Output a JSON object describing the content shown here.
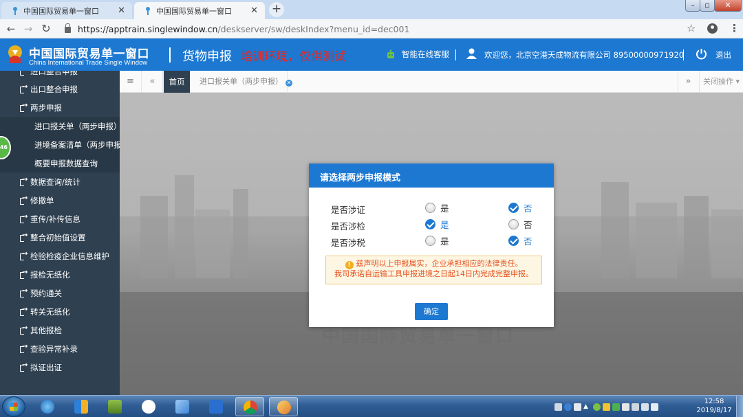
{
  "browser": {
    "tabs": [
      {
        "title": "中国国际贸易单一窗口",
        "active": false
      },
      {
        "title": "中国国际贸易单一窗口",
        "active": true
      }
    ],
    "url_host": "https://apptrain.singlewindow.cn",
    "url_path": "/deskserver/sw/deskIndex?menu_id=dec001"
  },
  "header": {
    "logo_cn": "中国国际贸易单一窗口",
    "logo_en": "China International Trade Single Window",
    "module_title": "货物申报",
    "env_warning": "培训环境，仅供测试",
    "online_service": "智能在线客服",
    "welcome": "欢迎您，北京空港天成物流有限公司 89500000971920",
    "logout": "退出"
  },
  "sidebar": {
    "cut_top": "进口整合申报",
    "items": [
      {
        "label": "出口整合申报"
      },
      {
        "label": "两步申报"
      }
    ],
    "sub_items": [
      {
        "label": "进口报关单（两步申报）",
        "active": true
      },
      {
        "label": "进境备案清单（两步申报）"
      },
      {
        "label": "概要申报数据查询"
      }
    ],
    "more_items": [
      {
        "label": "数据查询/统计"
      },
      {
        "label": "修撤单"
      },
      {
        "label": "重传/补传信息"
      },
      {
        "label": "整合初始值设置"
      },
      {
        "label": "检验检疫企业信息维护"
      },
      {
        "label": "报检无纸化"
      },
      {
        "label": "预约通关"
      },
      {
        "label": "转关无纸化"
      },
      {
        "label": "其他报检"
      },
      {
        "label": "查验异常补录"
      },
      {
        "label": "拟证出证"
      }
    ],
    "badge": "46"
  },
  "content_tabs": {
    "home": "首页",
    "doc_tab": "进口报关单（两步申报）",
    "close_ops": "关闭操作"
  },
  "main": {
    "watermark": "中国国际贸易单一窗口"
  },
  "modal": {
    "title": "请选择两步申报模式",
    "questions": [
      {
        "label": "是否涉证",
        "yes": "是",
        "no": "否",
        "selected": "no"
      },
      {
        "label": "是否涉检",
        "yes": "是",
        "no": "否",
        "selected": "yes"
      },
      {
        "label": "是否涉税",
        "yes": "是",
        "no": "否",
        "selected": "no"
      }
    ],
    "notice_line1": "兹声明以上申报属实，企业承担相应的法律责任。",
    "notice_line2": "我司承诺自运输工具申报进境之日起14日内完成完整申报。",
    "confirm": "确定"
  },
  "taskbar": {
    "time": "12:58",
    "date": "2019/8/17"
  },
  "colors": {
    "header_blue": "#1d78d1",
    "sidebar_bg": "#2f4050",
    "warning_red": "#e8251f",
    "notice_text": "#e5521f"
  }
}
